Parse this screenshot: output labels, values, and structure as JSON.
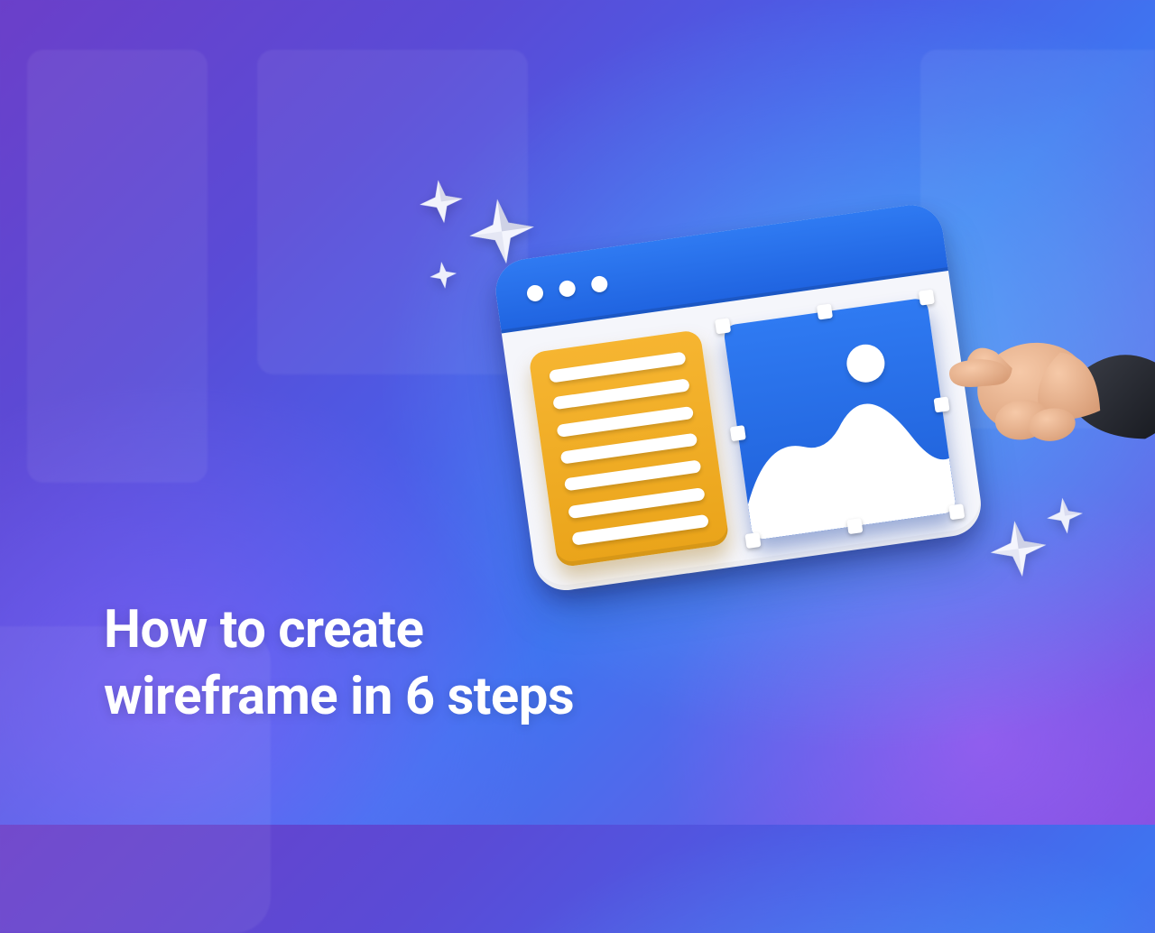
{
  "headline": {
    "line1": "How to create",
    "line2": "wireframe in 6 steps"
  },
  "colors": {
    "accent_blue": "#2f7af2",
    "accent_orange": "#f6b531",
    "background_start": "#6b3fc9",
    "background_end": "#3f74f0"
  },
  "illustration": {
    "window_dots": 3,
    "text_lines": 7,
    "selection_handles": 8
  }
}
